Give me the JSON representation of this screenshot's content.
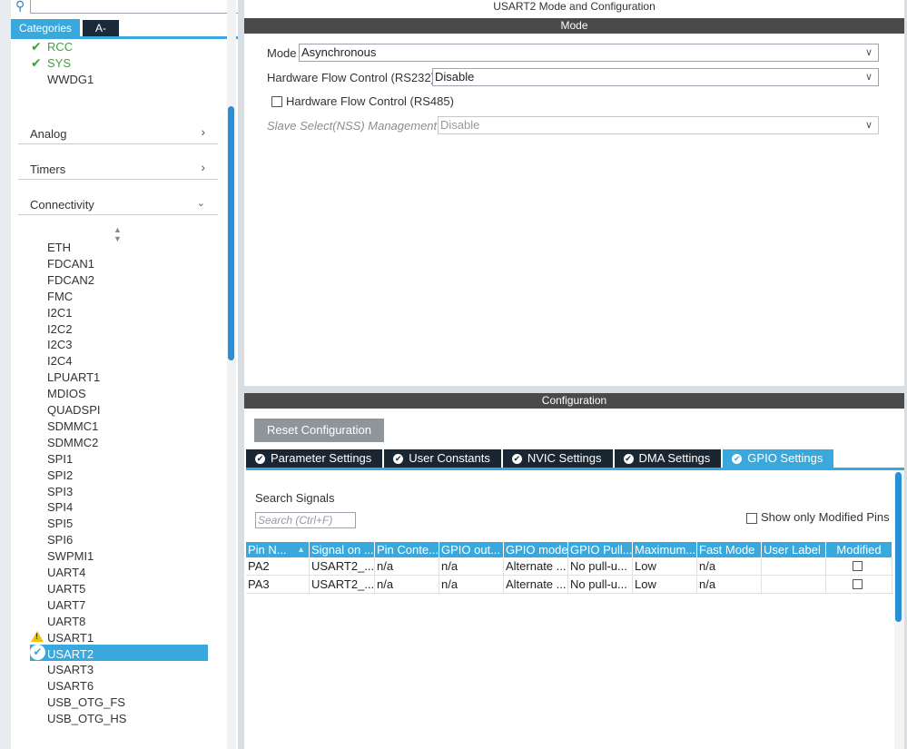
{
  "left": {
    "tabs": {
      "categories": "Categories",
      "az": "A->Z"
    },
    "top_items": [
      {
        "label": "RCC",
        "status": "ok"
      },
      {
        "label": "SYS",
        "status": "ok"
      },
      {
        "label": "WWDG1",
        "status": "none"
      }
    ],
    "categories": [
      {
        "label": "Analog",
        "chevron": ">"
      },
      {
        "label": "Timers",
        "chevron": ">"
      },
      {
        "label": "Connectivity",
        "chevron": "v"
      }
    ],
    "connectivity_items": [
      "ETH",
      "FDCAN1",
      "FDCAN2",
      "FMC",
      "I2C1",
      "I2C2",
      "I2C3",
      "I2C4",
      "LPUART1",
      "MDIOS",
      "QUADSPI",
      "SDMMC1",
      "SDMMC2",
      "SPI1",
      "SPI2",
      "SPI3",
      "SPI4",
      "SPI5",
      "SPI6",
      "SWPMI1",
      "UART4",
      "UART5",
      "UART7",
      "UART8",
      "USART1",
      "USART2",
      "USART3",
      "USART6",
      "USB_OTG_FS",
      "USB_OTG_HS"
    ],
    "warning_item": "USART1",
    "selected_item": "USART2"
  },
  "right": {
    "title": "USART2 Mode and Configuration",
    "mode_band": "Mode",
    "mode": {
      "mode_label": "Mode",
      "mode_value": "Asynchronous",
      "hwflow232_label": "Hardware Flow Control (RS232)",
      "hwflow232_value": "Disable",
      "hwflow485_label": "Hardware Flow Control (RS485)",
      "nss_label": "Slave Select(NSS) Management",
      "nss_value": "Disable"
    },
    "config_band": "Configuration",
    "reset_label": "Reset Configuration",
    "tabs": [
      {
        "label": "Parameter Settings",
        "active": false
      },
      {
        "label": "User Constants",
        "active": false
      },
      {
        "label": "NVIC Settings",
        "active": false
      },
      {
        "label": "DMA Settings",
        "active": false
      },
      {
        "label": "GPIO Settings",
        "active": true
      }
    ],
    "search_signals_label": "Search Signals",
    "search_placeholder": "Search (Ctrl+F)",
    "show_modified_label": "Show only Modified Pins",
    "table": {
      "columns": [
        "Pin N...",
        "Signal on ...",
        "Pin Conte...",
        "GPIO out...",
        "GPIO mode",
        "GPIO Pull...",
        "Maximum...",
        "Fast Mode",
        "User Label",
        "Modified"
      ],
      "rows": [
        [
          "PA2",
          "USART2_...",
          "n/a",
          "n/a",
          "Alternate ...",
          "No pull-u...",
          "Low",
          "n/a",
          "",
          ""
        ],
        [
          "PA3",
          "USART2_...",
          "n/a",
          "n/a",
          "Alternate ...",
          "No pull-u...",
          "Low",
          "n/a",
          "",
          ""
        ]
      ]
    }
  },
  "colors": {
    "accent": "#39a8dc",
    "dark": "#1b2633",
    "band": "#4a4a4a",
    "ok": "#39a63a",
    "warn": "#f4c20d"
  }
}
